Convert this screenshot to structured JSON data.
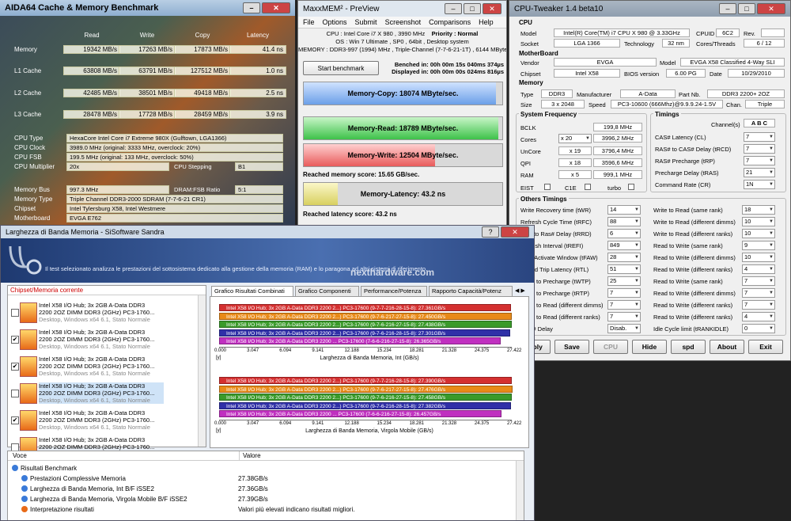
{
  "aida": {
    "title": "AIDA64 Cache & Memory Benchmark",
    "cols": [
      "Read",
      "Write",
      "Copy",
      "Latency"
    ],
    "rows": [
      {
        "label": "Memory",
        "vals": [
          "19342 MB/s",
          "17263 MB/s",
          "17873 MB/s",
          "41.4 ns"
        ]
      },
      {
        "label": "L1 Cache",
        "vals": [
          "63808 MB/s",
          "63791 MB/s",
          "127512 MB/s",
          "1.0 ns"
        ]
      },
      {
        "label": "L2 Cache",
        "vals": [
          "42485 MB/s",
          "38501 MB/s",
          "49418 MB/s",
          "2.5 ns"
        ]
      },
      {
        "label": "L3 Cache",
        "vals": [
          "28478 MB/s",
          "17728 MB/s",
          "28459 MB/s",
          "3.9 ns"
        ]
      }
    ],
    "cpu_type_l": "CPU Type",
    "cpu_type": "HexaCore Intel Core i7 Extreme 980X (Gulftown, LGA1366)",
    "cpu_clock_l": "CPU Clock",
    "cpu_clock": "3989.0 MHz (original: 3333 MHz, overclock: 20%)",
    "cpu_fsb_l": "CPU FSB",
    "cpu_fsb": "199.5 MHz (original: 133 MHz, overclock: 50%)",
    "cpu_mult_l": "CPU Multiplier",
    "cpu_mult": "20x",
    "stepping_l": "CPU Stepping",
    "stepping": "B1",
    "mem_bus_l": "Memory Bus",
    "mem_bus": "997.3 MHz",
    "ratio_l": "DRAM:FSB Ratio",
    "ratio": "5:1",
    "mem_type_l": "Memory Type",
    "mem_type": "Triple Channel DDR3-2000 SDRAM (7-7-6-21 CR1)",
    "chipset_l": "Chipset",
    "chipset": "Intel Tylersburg X58, Intel Westmere",
    "mobo_l": "Motherboard",
    "mobo": "EVGA E762"
  },
  "maxx": {
    "title": "MaxxMEM² - PreView",
    "menu": [
      "File",
      "Options",
      "Submit",
      "Screenshot",
      "Comparisons",
      "Help"
    ],
    "cpu_line": "CPU : Intel Core i7 X 980 , 3990 MHz",
    "priority": "Priority : Normal",
    "os_line": "OS : Win 7 Ultimate , SP0 , 64bit , Desktop system",
    "mem_line": "MEMORY : DDR3-997 (1994) MHz , Triple-Channel (7-7-6-21-1T) , 6144 MByte",
    "start": "Start benchmark",
    "benched": "Benched in: 00h 00m 15s 040ms 374µs",
    "displayed": "Displayed in: 00h 00m 00s 024ms 816µs",
    "copy": "Memory-Copy: 18074 MByte/sec.",
    "read": "Memory-Read: 18789 MByte/sec.",
    "write": "Memory-Write: 12504 MByte/sec.",
    "mem_score": "Reached memory score: 15.65 GB/sec.",
    "latency": "Memory-Latency: 43.2 ns",
    "lat_score": "Reached latency score: 43.2 ns",
    "copy_fill": 0.97,
    "read_fill": 0.98,
    "write_fill": 0.66,
    "latency_fill": 0.17
  },
  "cput": {
    "title": "CPU-Tweaker 1.4 beta10",
    "cpu_h": "CPU",
    "model_l": "Model",
    "model": "Intel(R) Core(TM) i7 CPU     X 980  @ 3.33GHz",
    "cpuid_l": "CPUID",
    "cpuid": "6C2",
    "rev_l": "Rev.",
    "rev": "",
    "socket_l": "Socket",
    "socket": "LGA 1366",
    "tech_l": "Technology",
    "tech": "32 nm",
    "cores_l": "Cores/Threads",
    "cores": "6 / 12",
    "mb_h": "MotherBoard",
    "vendor_l": "Vendor",
    "vendor": "EVGA",
    "mbmodel_l": "Model",
    "mbmodel": "EVGA X58 Classified 4-Way SLI",
    "chip_l": "Chipset",
    "chip": "Intel X58",
    "bios_l": "BIOS version",
    "bios": "6.00 PG",
    "date_l": "Date",
    "date": "10/29/2010",
    "mem_h": "Memory",
    "mtype_l": "Type",
    "mtype": "DDR3",
    "manu_l": "Manufacturer",
    "manu": "A-Data",
    "part_l": "Part Nb.",
    "part": "DDR3 2200+ 2OZ",
    "size_l": "Size",
    "size": "3 x 2048",
    "speed_l": "Speed",
    "speed": "PC3-10600 (666Mhz)@9.9.9.24-1.5V",
    "chan_l": "Chan.",
    "chan": "Triple",
    "freq_h": "System Frequency",
    "bclk_l": "BCLK",
    "bclk": "199,8 MHz",
    "cores2_l": "Cores",
    "cores_mult": "x 20",
    "cores_f": "3996,2 MHz",
    "uncore_l": "UnCore",
    "uncore_m": "x 19",
    "uncore_f": "3796,4 MHz",
    "qpi_l": "QPI",
    "qpi_m": "x 18",
    "qpi_f": "3596,6 MHz",
    "ram_l": "RAM",
    "ram_m": "x 5",
    "ram_f": "999,1 MHz",
    "eist": "EIST",
    "c1e": "C1E",
    "turbo": "turbo",
    "timings_h": "Timings",
    "channels_l": "Channel(s)",
    "channels": "A B C",
    "t_rows": [
      {
        "l": "CAS# Latency (CL)",
        "v": "7"
      },
      {
        "l": "RAS# to CAS# Delay (tRCD)",
        "v": "7"
      },
      {
        "l": "RAS# Precharge (tRP)",
        "v": "7"
      },
      {
        "l": "Precharge Delay (tRAS)",
        "v": "21"
      },
      {
        "l": "Command Rate (CR)",
        "v": "1N"
      }
    ],
    "other_h": "Others Timings",
    "o_left": [
      {
        "l": "Write Recovery time (tWR)",
        "v": "14"
      },
      {
        "l": "Refresh Cycle Time (tRFC)",
        "v": "88"
      },
      {
        "l": "Row to Ras# Delay (tRRD)",
        "v": "6"
      },
      {
        "l": "Refresh Interval (tREFI)",
        "v": "849"
      },
      {
        "l": "Four Activate Window (tFAW)",
        "v": "28"
      },
      {
        "l": "Round Trip Latency (RTL)",
        "v": "51"
      },
      {
        "l": "Read to Precharge (tWTP)",
        "v": "25"
      },
      {
        "l": "Read to Precharge (tRTP)",
        "v": "7"
      },
      {
        "l": "Read to Read (different dimms)",
        "v": "7"
      },
      {
        "l": "Read to Read (different ranks)",
        "v": "7"
      },
      {
        "l": "CAS# Delay",
        "v": "Disab."
      }
    ],
    "o_right": [
      {
        "l": "Write to Read (same rank)",
        "v": "18"
      },
      {
        "l": "Write to Read (different dimms)",
        "v": "10"
      },
      {
        "l": "Write to Read (different ranks)",
        "v": "10"
      },
      {
        "l": "Read to Write (same rank)",
        "v": "9"
      },
      {
        "l": "Read to Write (different dimms)",
        "v": "10"
      },
      {
        "l": "Read to Write (different ranks)",
        "v": "4"
      },
      {
        "l": "Read to Write (same rank)",
        "v": "7"
      },
      {
        "l": "Read to Write (different dimms)",
        "v": "7"
      },
      {
        "l": "Read to Write (different ranks)",
        "v": "7"
      },
      {
        "l": "Read to Write (different ranks)",
        "v": "4"
      },
      {
        "l": "Idle Cycle limit (tRANKIDLE)",
        "v": "0"
      }
    ],
    "buttons": [
      "Apply",
      "Save",
      "CPU",
      "Hide",
      "spd",
      "About",
      "Exit"
    ]
  },
  "sandra": {
    "title": "Larghezza di Banda Memoria - SiSoftware Sandra",
    "banner": "Il test selezionato analizza le prestazioni del sottosistema dedicato alla gestione della memoria (RAM) e lo paragona ad altri sistemi di riferimento.",
    "watermark": "nexthardware.com",
    "list_h": "Chipset/Memoria corrente",
    "items": [
      {
        "a": "Intel X58 I/O Hub; 3x 2GB A-Data DDR3",
        "b": "2200 2OZ DIMM DDR3 (2GHz) PC3-1760...",
        "c": "Desktop, Windows x64 6.1, Stato Normale",
        "chk": ""
      },
      {
        "a": "Intel X58 I/O Hub; 3x 2GB A-Data DDR3",
        "b": "2200 2OZ DIMM DDR3 (2GHz) PC3-1760...",
        "c": "Desktop, Windows x64 6.1, Stato Normale",
        "chk": "✔"
      },
      {
        "a": "Intel X58 I/O Hub; 3x 2GB A-Data DDR3",
        "b": "2200 2OZ DIMM DDR3 (2GHz) PC3-1760...",
        "c": "Desktop, Windows x64 6.1, Stato Normale",
        "chk": "✔"
      },
      {
        "a": "Intel X58 I/O Hub; 3x 2GB A-Data DDR3",
        "b": "2200 2OZ DIMM DDR3 (2GHz) PC3-1760...",
        "c": "Desktop, Windows x64 6.1, Stato Normale",
        "chk": ""
      },
      {
        "a": "Intel X58 I/O Hub; 3x 2GB A-Data DDR3",
        "b": "2200 2OZ DIMM DDR3 (2GHz) PC3-1760...",
        "c": "Desktop, Windows x64 6.1, Stato Normale",
        "chk": "✔"
      },
      {
        "a": "Intel X58 I/O Hub; 3x 2GB A-Data DDR3",
        "b": "2200 2OZ DIMM DDR3 (2GHz) PC3-1760...",
        "c": "",
        "chk": ""
      }
    ],
    "tabs": [
      "Grafico Risultati Combinati",
      "Grafico Componenti",
      "Performance/Potenza",
      "Rapporto Capacità/Potenz"
    ],
    "axis_ticks": [
      "0.000",
      "3.047",
      "6.094",
      "9.141",
      "12.188",
      "15.234",
      "18.281",
      "21.328",
      "24.375",
      "27.422"
    ],
    "y_unit": "[y]",
    "chart1_title": "Larghezza di Banda Memoria, Int (GB/s)",
    "chart2_title": "Larghezza di Banda Memoria, Virgola Mobile (GB/s)",
    "bars_int": [
      {
        "t": "Intel X58 I/O Hub; 3x 2GB A-Data DDR3 2200 2...) PC3-17600 (9-7-7-216-28-15-8): 27.361GB/s",
        "v": 27.361,
        "c": "#d43030"
      },
      {
        "t": "Intel X58 I/O Hub; 3x 2GB A-Data DDR3 2200 2...) PC3-17600 (9-7-6-217-27-15-8): 27.450GB/s",
        "v": 27.45,
        "c": "#e88a18"
      },
      {
        "t": "Intel X58 I/O Hub; 3x 2GB A-Data DDR3 2200 2...) PC3-17600 (9-7-6-216-27-15-8): 27.438GB/s",
        "v": 27.438,
        "c": "#3a9a2a"
      },
      {
        "t": "Intel X58 I/O Hub; 3x 2GB A-Data DDR3 2200 2...) PC3-17600 (9-7-6-216-28-15-8): 27.301GB/s",
        "v": 27.301,
        "c": "#3030a8"
      },
      {
        "t": "Intel X58 I/O Hub; 3x 2GB A-Data DDR3 2200 ... PC3-17600 (7-6-6-216-27-15-8): 26.365GB/s",
        "v": 26.365,
        "c": "#c030c0"
      }
    ],
    "bars_fp": [
      {
        "t": "Intel X58 I/O Hub; 3x 2GB A-Data DDR3 2200 2...) PC3-17600 (9-7-7-216-28-15-8): 27.390GB/s",
        "v": 27.39,
        "c": "#d43030"
      },
      {
        "t": "Intel X58 I/O Hub; 3x 2GB A-Data DDR3 2200 2...) PC3-17600 (9-7-6-217-27-15-8): 27.476GB/s",
        "v": 27.476,
        "c": "#e88a18"
      },
      {
        "t": "Intel X58 I/O Hub; 3x 2GB A-Data DDR3 2200 2...) PC3-17600 (9-7-6-216-27-15-8): 27.458GB/s",
        "v": 27.458,
        "c": "#3a9a2a"
      },
      {
        "t": "Intel X58 I/O Hub; 3x 2GB A-Data DDR3 2200 2...) PC3-17600 (9-7-6-216-28-15-8): 27.382GB/s",
        "v": 27.382,
        "c": "#3030a8"
      },
      {
        "t": "Intel X58 I/O Hub; 3x 2GB A-Data DDR3 2200 ... PC3-17600 (7-6-6-216-27-15-8): 26.457GB/s",
        "v": 26.457,
        "c": "#c030c0"
      }
    ],
    "col_voce": "Voce",
    "col_valore": "Valore",
    "results": [
      {
        "l": "Risultati Benchmark",
        "v": ""
      },
      {
        "l": "Prestazioni Complessive Memoria",
        "v": "27.38GB/s"
      },
      {
        "l": "Larghezza di Banda Memoria, Int B/F iSSE2",
        "v": "27.36GB/s"
      },
      {
        "l": "Larghezza di Banda Memoria, Virgola Mobile B/F iSSE2",
        "v": "27.39GB/s"
      },
      {
        "l": "Interpretazione risultati",
        "v": "Valori più elevati indicano risultati migliori."
      }
    ]
  }
}
